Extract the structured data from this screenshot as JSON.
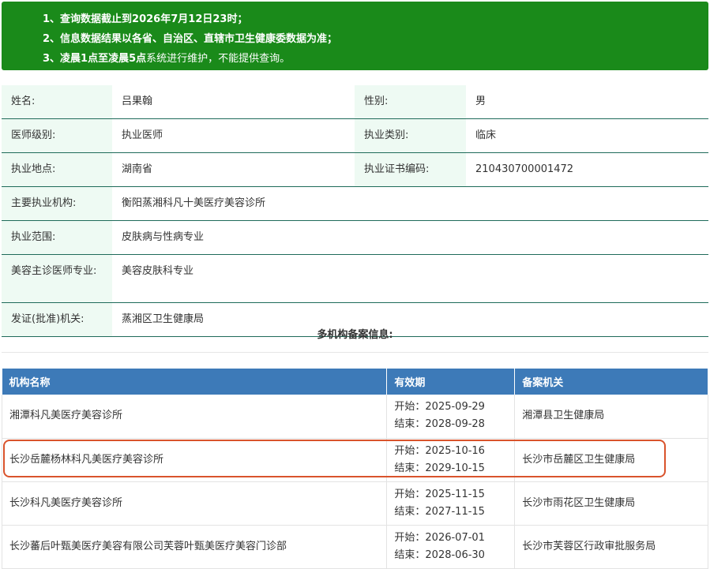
{
  "notice": {
    "line1": {
      "pre": "1、查询数据截止到",
      "bold": "2026年7月12日23时",
      "post": "；"
    },
    "line2": {
      "text": "2、信息数据结果以各省、自治区、直辖市卫生健康委数据为准；"
    },
    "line3": {
      "pre": "3、",
      "bold": "凌晨1点至凌晨5点",
      "post": "系统进行维护，不能提供查询。"
    }
  },
  "doctor": {
    "name_label": "姓名:",
    "name": "吕果翰",
    "gender_label": "性别:",
    "gender": "男",
    "level_label": "医师级别:",
    "level": "执业医师",
    "category_label": "执业类别:",
    "category": "临床",
    "location_label": "执业地点:",
    "location": "湖南省",
    "cert_label": "执业证书编码:",
    "cert": "210430700001472",
    "org_label": "主要执业机构:",
    "org": "衡阳蒸湘科凡十美医疗美容诊所",
    "scope_label": "执业范围:",
    "scope": "皮肤病与性病专业",
    "cosmetic_label": "美容主诊医师专业:",
    "cosmetic": "美容皮肤科专业",
    "issuer_label": "发证(批准)机关:",
    "issuer": "蒸湘区卫生健康局"
  },
  "multi": {
    "title": "多机构备案信息:",
    "headers": [
      "机构名称",
      "有效期",
      "备案机关"
    ],
    "rows": [
      {
        "name": "湘潭科凡美医疗美容诊所",
        "start": "开始：2025-09-29",
        "end": "结束：2028-09-28",
        "authority": "湘潭县卫生健康局"
      },
      {
        "name": "长沙岳麓杨林科凡美医疗美容诊所",
        "start": "开始：2025-10-16",
        "end": "结束：2029-10-15",
        "authority": "长沙市岳麓区卫生健康局"
      },
      {
        "name": "长沙科凡美医疗美容诊所",
        "start": "开始：2025-11-15",
        "end": "结束：2027-11-15",
        "authority": "长沙市雨花区卫生健康局"
      },
      {
        "name": "长沙蕃后叶甄美医疗美容有限公司芙蓉叶甄美医疗美容门诊部",
        "start": "开始：2026-07-01",
        "end": "结束：2028-06-30",
        "authority": "长沙市芙蓉区行政审批服务局"
      }
    ]
  },
  "colors": {
    "notice_bg": "#1a8a1a",
    "header_bg": "#3d7ab8",
    "label_bg": "#eefaf3",
    "highlight": "#d9532c"
  }
}
